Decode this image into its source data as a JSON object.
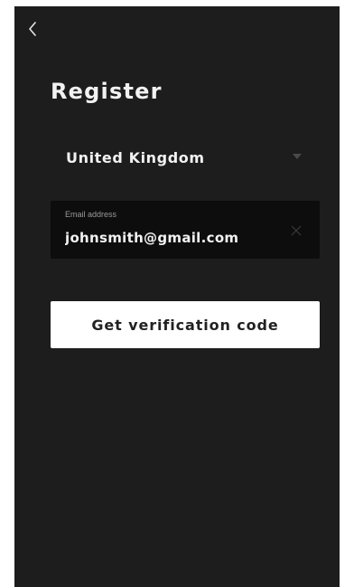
{
  "header": {
    "back_icon": "chevron-left-icon",
    "title": "Register"
  },
  "country": {
    "selected": "United Kingdom",
    "dropdown_icon": "caret-down-icon"
  },
  "email": {
    "label": "Email address",
    "value": "johnsmith@gmail.com",
    "clear_icon": "close-icon"
  },
  "actions": {
    "get_code_label": "Get verification code"
  },
  "colors": {
    "background": "#1d1d1d",
    "field_background": "#0d0d0d",
    "primary_text": "#f2f2f2",
    "button_background": "#ffffff",
    "button_text": "#222222"
  }
}
